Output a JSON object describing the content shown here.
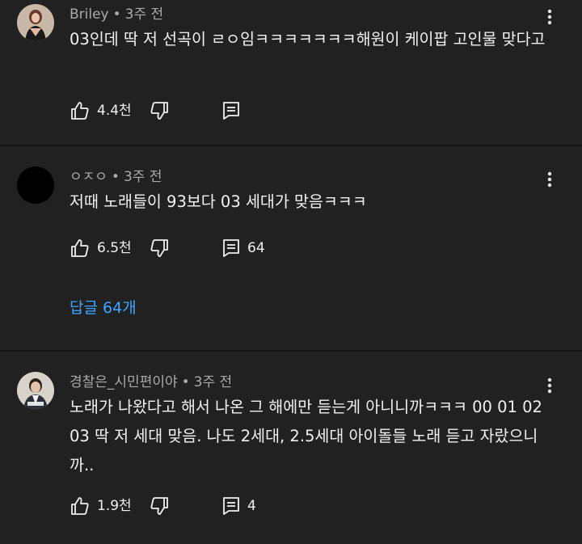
{
  "comments": [
    {
      "author": "Briley",
      "time": "3주 전",
      "text": "03인데 딱 저 선곡이 ㄹㅇ임ㅋㅋㅋㅋㅋㅋㅋ해원이 케이팝 고인물 맞다고",
      "likes": "4.4천",
      "reply_count": "",
      "avatar_icon": "profile-photo"
    },
    {
      "author": "ㅇㅈㅇ",
      "time": "3주 전",
      "text": "저때 노래들이 93보다 03 세대가 맞음ㅋㅋㅋ",
      "likes": "6.5천",
      "reply_count": "64",
      "replies_link": "답글 64개",
      "avatar_icon": "black-circle"
    },
    {
      "author": "경찰은_시민편이야",
      "time": "3주 전",
      "text": "노래가 나왔다고 해서 나온 그 해에만 듣는게 아니니까ㅋㅋㅋ 00 01 02 03 딱 저 세대 맞음. 나도 2세대, 2.5세대 아이돌들 노래 듣고 자랐으니까..",
      "likes": "1.9천",
      "reply_count": "4",
      "avatar_icon": "profile-photo"
    }
  ],
  "meta_separator": "•",
  "colors": {
    "background": "#212121",
    "text": "#f1f1f1",
    "secondary_text": "#aaaaaa",
    "link": "#3ea6ff",
    "divider": "#151515"
  }
}
